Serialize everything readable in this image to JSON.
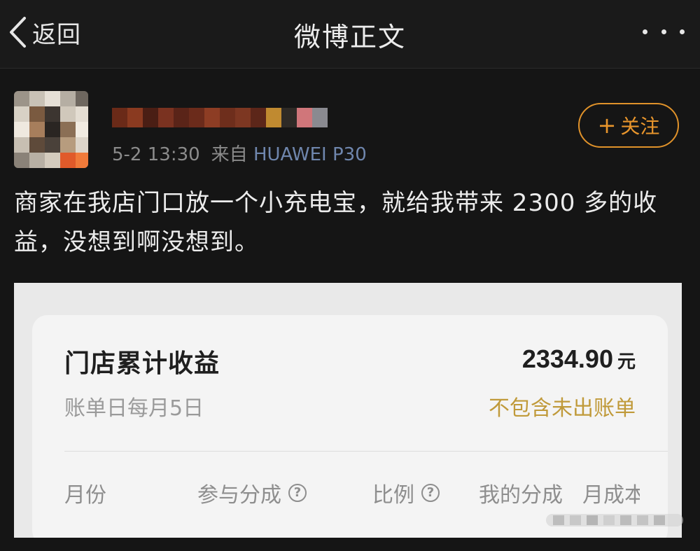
{
  "navbar": {
    "back_label": "返回",
    "title": "微博正文"
  },
  "post": {
    "timestamp": "5-2 13:30",
    "source_prefix": "来自",
    "device": "HUAWEI P30",
    "follow_label": "关注",
    "text": "商家在我店门口放一个小充电宝，就给我带来 2300 多的收益，没想到啊没想到。"
  },
  "embed": {
    "title": "门店累计收益",
    "amount": "2334.90",
    "unit": "元",
    "billing_day": "账单日每月5日",
    "note": "不包含未出账单",
    "columns": {
      "month": "月份",
      "share": "参与分成",
      "ratio": "比例",
      "my_share": "我的分成",
      "monthly": "月成本"
    }
  },
  "colors": {
    "accent_orange": "#e8952c",
    "device_link": "#6f86ad",
    "note_gold": "#c09a3a"
  },
  "icons": [
    "chevron-left-icon",
    "more-dots-icon",
    "plus-icon",
    "question-circle-icon"
  ]
}
